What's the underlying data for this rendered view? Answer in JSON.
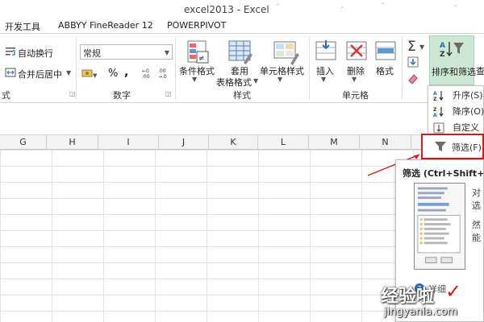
{
  "window": {
    "title": "excel2013 - Excel"
  },
  "menu_tabs": [
    "开发工具",
    "ABBYY FineReader 12",
    "POWERPIVOT"
  ],
  "ribbon": {
    "alignment": {
      "wrap_text": "自动换行",
      "merge_center": "合并后居中",
      "group_label": "式"
    },
    "number": {
      "format_value": "常规",
      "percent": "%",
      "comma": ",",
      "group_label": "数字"
    },
    "styles": {
      "conditional_format": "条件格式",
      "table_format_line1": "套用",
      "table_format_line2": "表格格式",
      "cell_styles": "单元格样式",
      "group_label": "样式"
    },
    "cells": {
      "insert": "插入",
      "delete": "删除",
      "format": "格式",
      "group_label": "单元格"
    },
    "editing": {
      "sort_filter": "排序和筛选",
      "find_partial": "查",
      "sigma": "Σ"
    }
  },
  "columns": [
    "G",
    "H",
    "I",
    "J",
    "K",
    "L",
    "M",
    "N"
  ],
  "sort_menu": {
    "ascending": "升序(S)",
    "descending": "降序(O)",
    "custom": "自定义排",
    "filter": "筛选(F)"
  },
  "tooltip": {
    "title": "筛选 (Ctrl+Shift+L)",
    "side_text_1": "对",
    "side_text_2": "选",
    "side_text_3": "然",
    "side_text_4": "能",
    "help": "详细"
  },
  "watermark": {
    "main": "经验啦",
    "check": "✓",
    "url": "jingyanla.com"
  },
  "colors": {
    "accent_green": "#217346",
    "highlight_red": "#d21a1a",
    "sort_highlight": "#cde7d6"
  }
}
